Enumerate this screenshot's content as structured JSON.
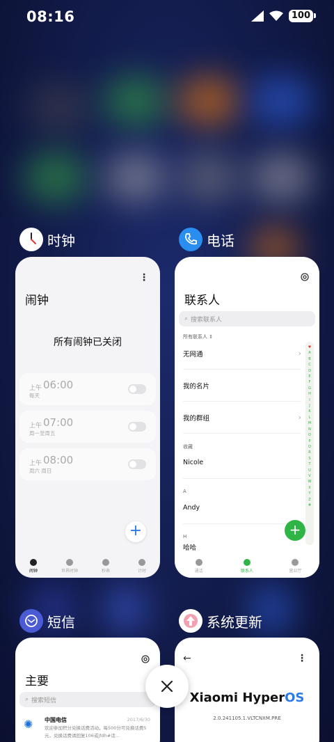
{
  "status_bar": {
    "time": "08:16",
    "battery": "100"
  },
  "apps": {
    "clock": {
      "label": "时钟",
      "title": "闹钟",
      "empty_text": "所有闹钟已关闭",
      "alarms": [
        {
          "ampm": "上午",
          "time": "06:00",
          "repeat": "每天",
          "enabled": false
        },
        {
          "ampm": "上午",
          "time": "07:00",
          "repeat": "周一至周五",
          "enabled": false
        },
        {
          "ampm": "上午",
          "time": "08:00",
          "repeat": "周六 周日",
          "enabled": false
        }
      ],
      "tabs": [
        "闹钟",
        "世界时钟",
        "秒表",
        "计时"
      ]
    },
    "phone": {
      "label": "电话",
      "title": "联系人",
      "search_placeholder": "搜索联系人",
      "all_contacts": "所有联系人 ⇕",
      "rows": [
        "无网通",
        "我的名片",
        "我的群组"
      ],
      "favorites_header": "收藏",
      "favorite": "Nicole",
      "section_a": "A",
      "contact_a": "Andy",
      "section_h": "H",
      "contact_h": "哈哈",
      "alpha_index": [
        "♥",
        "A",
        "B",
        "C",
        "D",
        "E",
        "F",
        "G",
        "H",
        "I",
        "J",
        "K",
        "L",
        "M",
        "N",
        "O",
        "P",
        "Q",
        "R",
        "S",
        "T",
        "U",
        "V",
        "W",
        "X",
        "Y",
        "Z",
        "#"
      ],
      "tabs": [
        "通话",
        "联系人",
        "营业厅"
      ]
    },
    "sms": {
      "label": "短信",
      "title": "主要",
      "search_placeholder": "搜索短信",
      "message": {
        "sender": "中国电信",
        "date": "2017/6/30",
        "preview": "欢迎参加积分兑换话费活动，每500分可兑换话费5元，兑换话费请回复106或jfdh#话..."
      }
    },
    "update": {
      "label": "系统更新",
      "brand": "Xiaomi Hyper",
      "brand_os": "OS",
      "version": "2.0.241105.1.VLTCNXM.PRE"
    }
  },
  "colors": {
    "accent_blue": "#2a7ae8",
    "accent_green": "#2fb545"
  }
}
